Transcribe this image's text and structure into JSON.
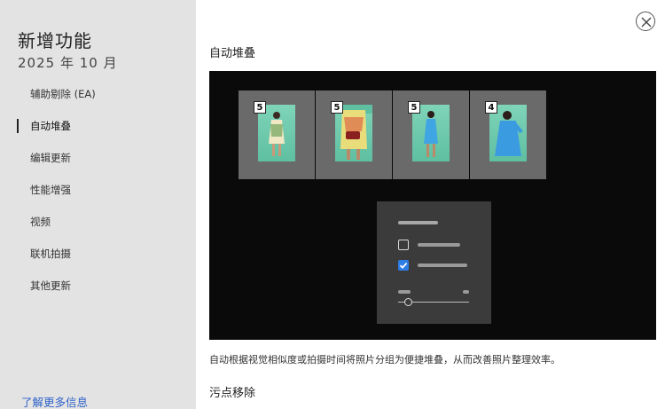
{
  "sidebar": {
    "title": "新增功能",
    "subtitle": "2025 年 10 月",
    "items": [
      {
        "label": "辅助剔除 (EA)",
        "active": false
      },
      {
        "label": "自动堆叠",
        "active": true
      },
      {
        "label": "编辑更新",
        "active": false
      },
      {
        "label": "性能增强",
        "active": false
      },
      {
        "label": "视频",
        "active": false
      },
      {
        "label": "联机拍摄",
        "active": false
      },
      {
        "label": "其他更新",
        "active": false
      }
    ],
    "learn_more": "了解更多信息"
  },
  "main": {
    "section_title": "自动堆叠",
    "caption": "自动根据视觉相似度或拍摄时间将照片分组为便捷堆叠，从而改善照片整理效率。",
    "next_section_title": "污点移除",
    "stacks": [
      {
        "count": "5",
        "dress_color": "#f0e7c4"
      },
      {
        "count": "5",
        "dress_color": "#e9dc7a"
      },
      {
        "count": "5",
        "dress_color": "#3fa6e3"
      },
      {
        "count": "4",
        "dress_color": "#3b9be0"
      }
    ]
  },
  "colors": {
    "accent": "#2e7ce6",
    "link": "#2f63c9",
    "sidebar_bg": "#e3e3e3",
    "video_bg": "#0a0a0a"
  },
  "icons": {
    "close": "close-icon",
    "checkbox_checked": "checkmark-icon"
  }
}
